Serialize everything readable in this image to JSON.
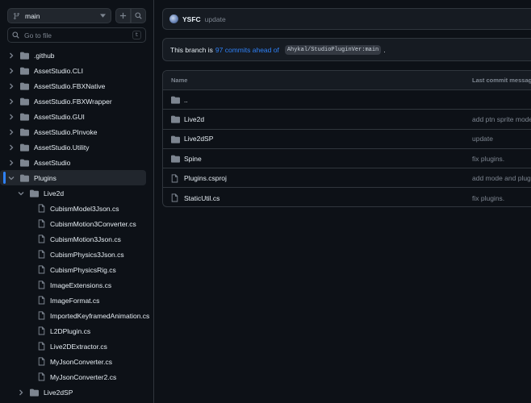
{
  "colors": {
    "bg": "#0d1117",
    "border": "#30363d",
    "accent": "#2f81f7",
    "muted": "#7d8590",
    "text": "#e6edf3"
  },
  "sidebar": {
    "branch": "main",
    "goto_placeholder": "Go to file",
    "goto_shortcut": "t",
    "tree": [
      {
        "label": ".github",
        "type": "folder",
        "level": 0,
        "expanded": false
      },
      {
        "label": "AssetStudio.CLI",
        "type": "folder",
        "level": 0,
        "expanded": false
      },
      {
        "label": "AssetStudio.FBXNative",
        "type": "folder",
        "level": 0,
        "expanded": false
      },
      {
        "label": "AssetStudio.FBXWrapper",
        "type": "folder",
        "level": 0,
        "expanded": false
      },
      {
        "label": "AssetStudio.GUI",
        "type": "folder",
        "level": 0,
        "expanded": false
      },
      {
        "label": "AssetStudio.PInvoke",
        "type": "folder",
        "level": 0,
        "expanded": false
      },
      {
        "label": "AssetStudio.Utility",
        "type": "folder",
        "level": 0,
        "expanded": false
      },
      {
        "label": "AssetStudio",
        "type": "folder",
        "level": 0,
        "expanded": false
      },
      {
        "label": "Plugins",
        "type": "folder",
        "level": 0,
        "expanded": true,
        "selected": true
      },
      {
        "label": "Live2d",
        "type": "folder",
        "level": 1,
        "expanded": true
      },
      {
        "label": "CubismModel3Json.cs",
        "type": "file",
        "level": 2
      },
      {
        "label": "CubismMotion3Converter.cs",
        "type": "file",
        "level": 2
      },
      {
        "label": "CubismMotion3Json.cs",
        "type": "file",
        "level": 2
      },
      {
        "label": "CubismPhysics3Json.cs",
        "type": "file",
        "level": 2
      },
      {
        "label": "CubismPhysicsRig.cs",
        "type": "file",
        "level": 2
      },
      {
        "label": "ImageExtensions.cs",
        "type": "file",
        "level": 2
      },
      {
        "label": "ImageFormat.cs",
        "type": "file",
        "level": 2
      },
      {
        "label": "ImportedKeyframedAnimation.cs",
        "type": "file",
        "level": 2
      },
      {
        "label": "L2DPlugin.cs",
        "type": "file",
        "level": 2
      },
      {
        "label": "Live2DExtractor.cs",
        "type": "file",
        "level": 2
      },
      {
        "label": "MyJsonConverter.cs",
        "type": "file",
        "level": 2
      },
      {
        "label": "MyJsonConverter2.cs",
        "type": "file",
        "level": 2
      },
      {
        "label": "Live2dSP",
        "type": "folder",
        "level": 1,
        "expanded": false
      }
    ]
  },
  "commit": {
    "author": "YSFC",
    "message": "update"
  },
  "ahead": {
    "prefix": "This branch is",
    "link": "97 commits ahead of",
    "ref": "Ahykal/StudioPluginVer:main",
    "suffix": "."
  },
  "files": {
    "col_name": "Name",
    "col_msg": "Last commit message",
    "rows": [
      {
        "name": "..",
        "type": "folder",
        "msg": ""
      },
      {
        "name": "Live2d",
        "type": "folder",
        "msg": "add ptn sprite mode"
      },
      {
        "name": "Live2dSP",
        "type": "folder",
        "msg": "update"
      },
      {
        "name": "Spine",
        "type": "folder",
        "msg": "fix plugins."
      },
      {
        "name": "Plugins.csproj",
        "type": "file",
        "msg": "add mode and plugi"
      },
      {
        "name": "StaticUtil.cs",
        "type": "file",
        "msg": "fix plugins."
      }
    ]
  }
}
